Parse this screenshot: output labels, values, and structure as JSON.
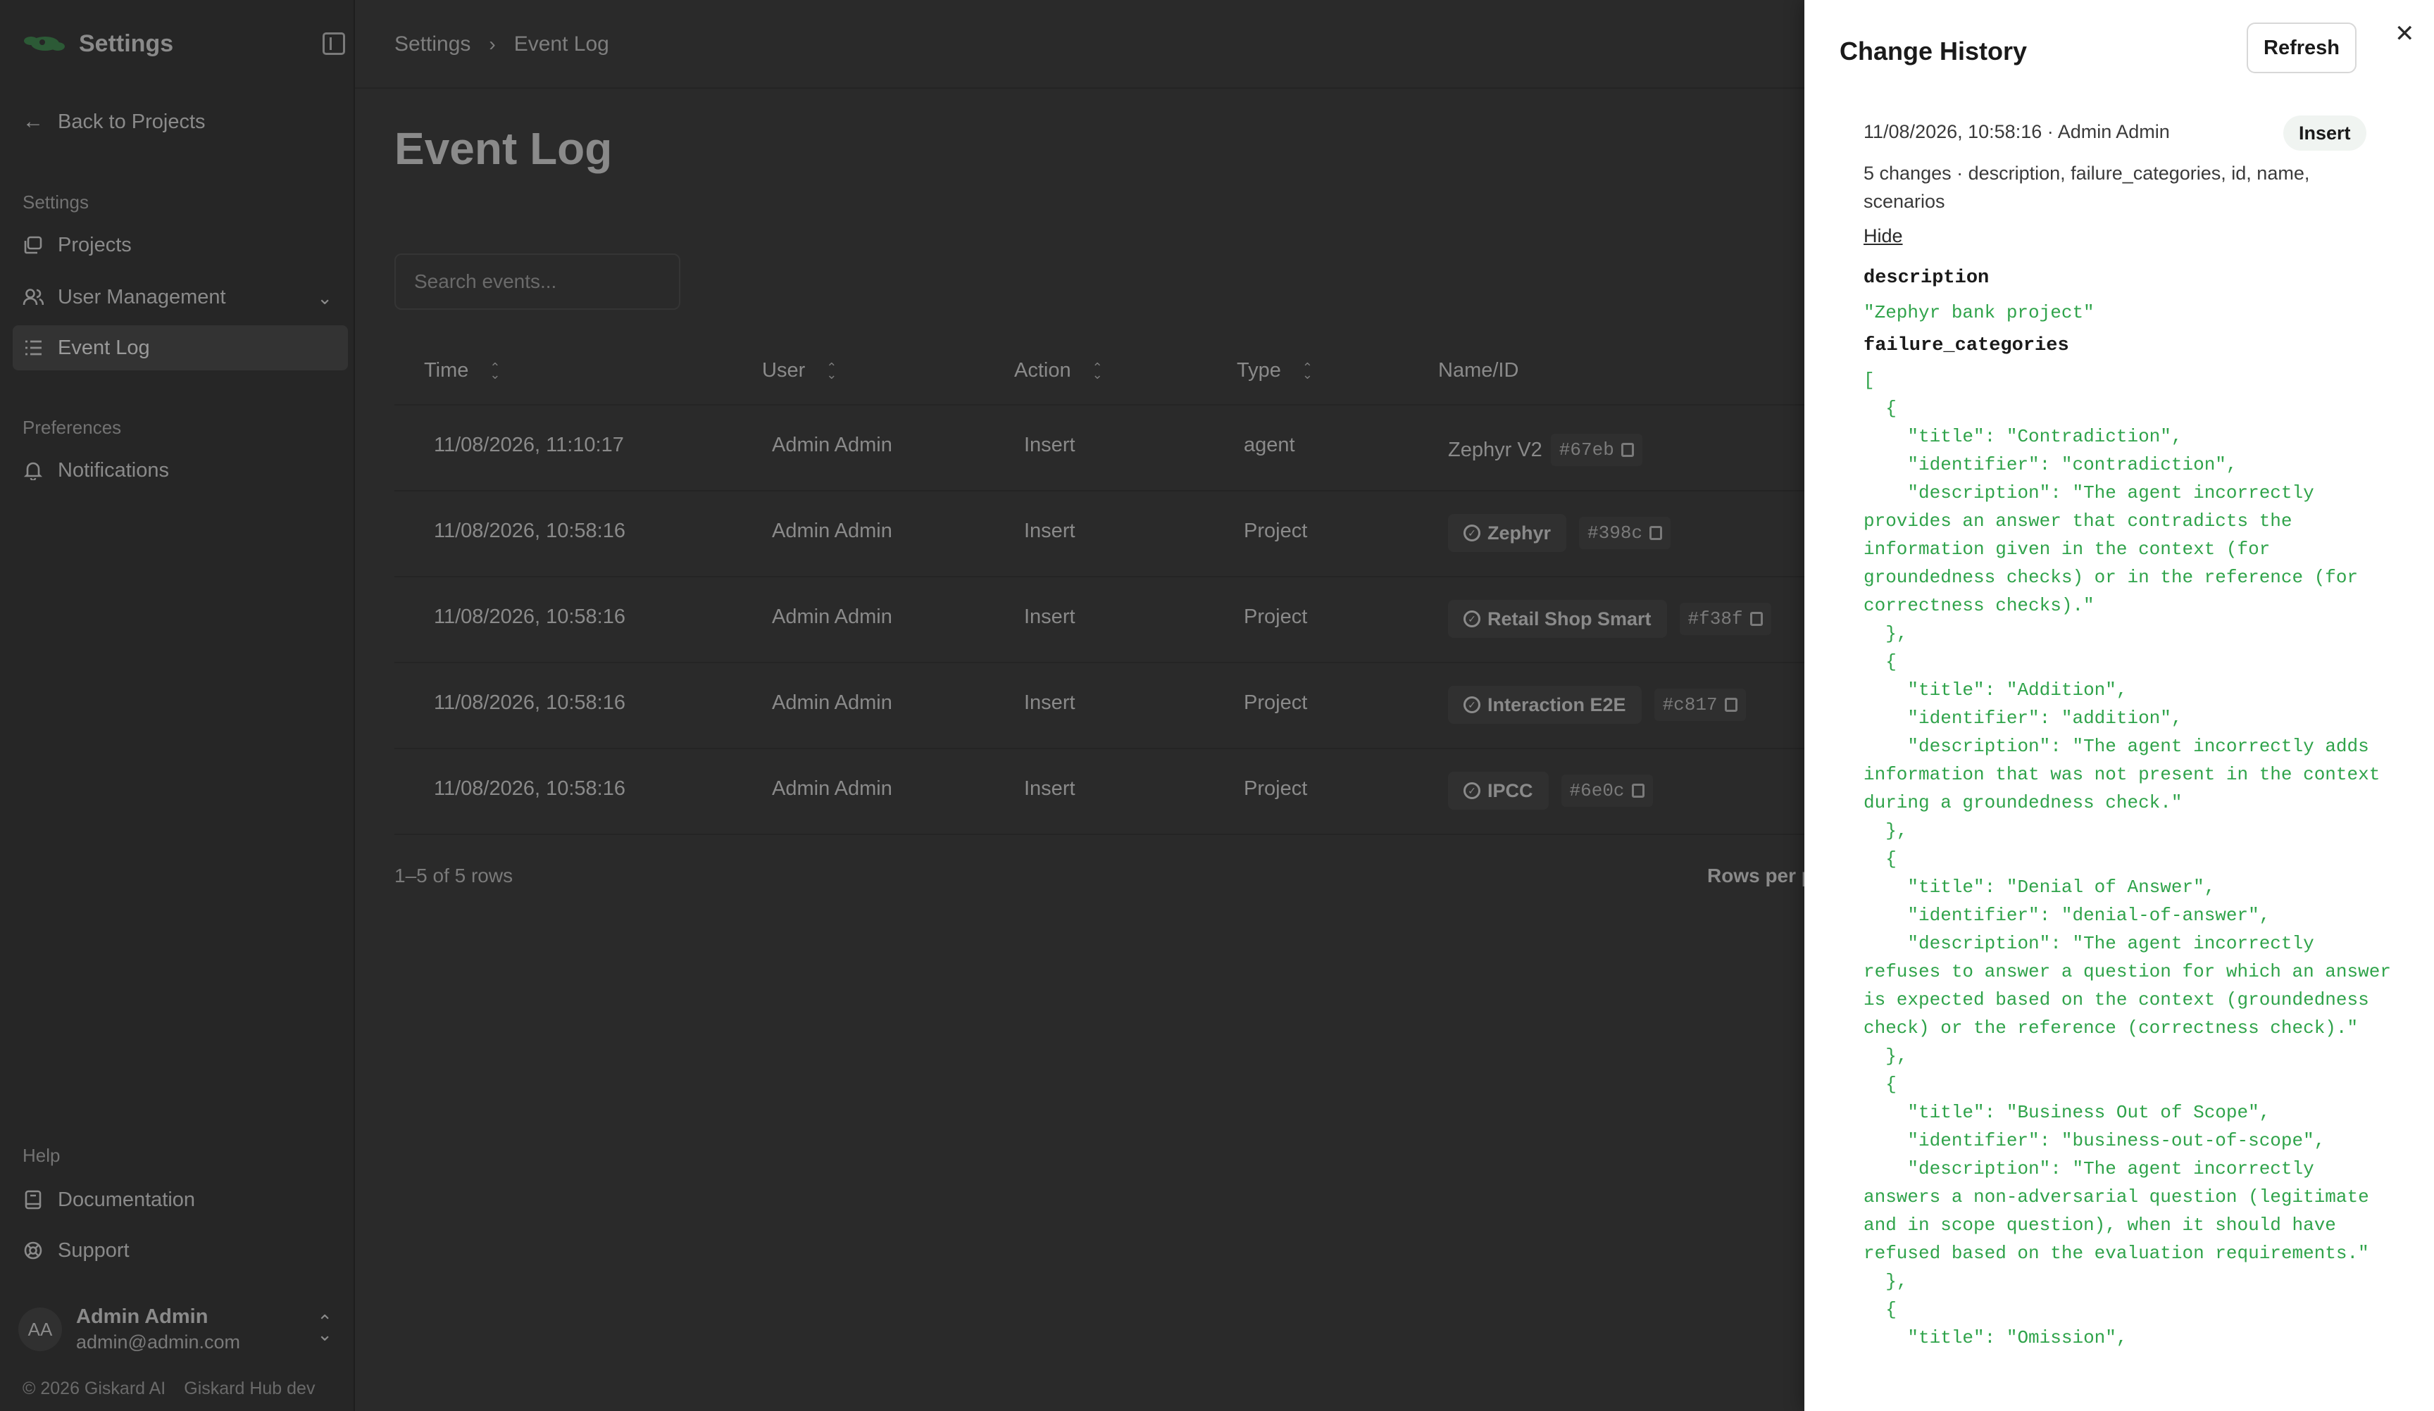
{
  "sidebar": {
    "title": "Settings",
    "back_label": "Back to Projects",
    "section_settings": "Settings",
    "items": [
      {
        "label": "Projects"
      },
      {
        "label": "User Management"
      },
      {
        "label": "Event Log"
      }
    ],
    "section_preferences": "Preferences",
    "notifications_label": "Notifications",
    "section_help": "Help",
    "documentation_label": "Documentation",
    "support_label": "Support",
    "user": {
      "initials": "AA",
      "name": "Admin Admin",
      "email": "admin@admin.com"
    },
    "footer_copyright": "© 2026 Giskard AI",
    "footer_version": "Giskard Hub dev"
  },
  "breadcrumb": {
    "root": "Settings",
    "current": "Event Log"
  },
  "page_title": "Event Log",
  "search": {
    "placeholder": "Search events..."
  },
  "table": {
    "headers": {
      "time": "Time",
      "user": "User",
      "action": "Action",
      "type": "Type",
      "name_id": "Name/ID"
    },
    "rows": [
      {
        "time": "11/08/2026, 11:10:17",
        "user": "Admin Admin",
        "action": "Insert",
        "type": "agent",
        "name": "Zephyr V2",
        "id": "#67eb",
        "pill": false
      },
      {
        "time": "11/08/2026, 10:58:16",
        "user": "Admin Admin",
        "action": "Insert",
        "type": "Project",
        "name": "Zephyr",
        "id": "#398c",
        "pill": true
      },
      {
        "time": "11/08/2026, 10:58:16",
        "user": "Admin Admin",
        "action": "Insert",
        "type": "Project",
        "name": "Retail Shop Smart",
        "id": "#f38f",
        "pill": true
      },
      {
        "time": "11/08/2026, 10:58:16",
        "user": "Admin Admin",
        "action": "Insert",
        "type": "Project",
        "name": "Interaction E2E",
        "id": "#c817",
        "pill": true
      },
      {
        "time": "11/08/2026, 10:58:16",
        "user": "Admin Admin",
        "action": "Insert",
        "type": "Project",
        "name": "IPCC",
        "id": "#6e0c",
        "pill": true
      }
    ],
    "rows_info": "1–5 of 5 rows",
    "rows_per_page_label": "Rows per p"
  },
  "drawer": {
    "title": "Change History",
    "refresh_label": "Refresh",
    "entry": {
      "meta": "11/08/2026, 10:58:16 · Admin Admin",
      "badge": "Insert",
      "summary": "5 changes · description, failure_categories, id, name, scenarios",
      "hide_label": "Hide",
      "field_description": "description",
      "description_value": "\"Zephyr bank project\"",
      "field_failure_categories": "failure_categories",
      "failure_categories_json": "[\n  {\n    \"title\": \"Contradiction\",\n    \"identifier\": \"contradiction\",\n    \"description\": \"The agent incorrectly provides an answer that contradicts the information given in the context (for groundedness checks) or in the reference (for correctness checks).\"\n  },\n  {\n    \"title\": \"Addition\",\n    \"identifier\": \"addition\",\n    \"description\": \"The agent incorrectly adds information that was not present in the context during a groundedness check.\"\n  },\n  {\n    \"title\": \"Denial of Answer\",\n    \"identifier\": \"denial-of-answer\",\n    \"description\": \"The agent incorrectly refuses to answer a question for which an answer is expected based on the context (groundedness check) or the reference (correctness check).\"\n  },\n  {\n    \"title\": \"Business Out of Scope\",\n    \"identifier\": \"business-out-of-scope\",\n    \"description\": \"The agent incorrectly answers a non-adversarial question (legitimate and in scope question), when it should have refused based on the evaluation requirements.\"\n  },\n  {\n    \"title\": \"Omission\","
    }
  },
  "colors": {
    "accent_green": "#2fa34a",
    "overlay_bg": "#2a2a2a",
    "drawer_bg": "#ffffff"
  }
}
